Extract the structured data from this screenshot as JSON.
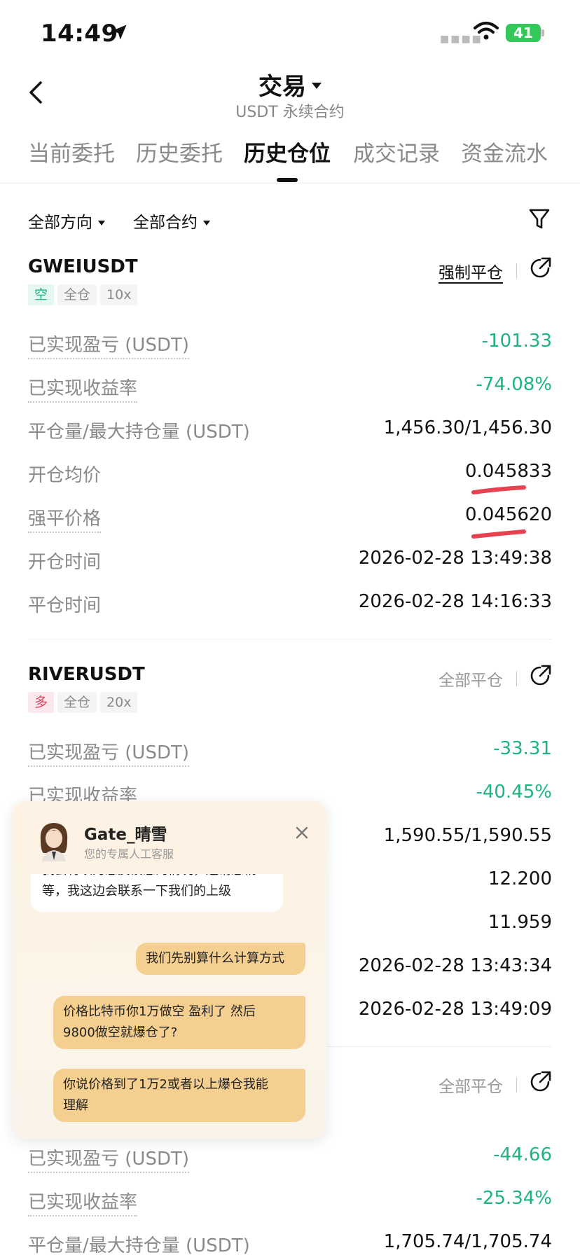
{
  "status_bar": {
    "time": "14:49",
    "battery": "41",
    "colors": {
      "battery": "#34c759"
    }
  },
  "header": {
    "title": "交易",
    "subtitle": "USDT 永续合约"
  },
  "tabs": [
    {
      "label": "当前委托",
      "active": false
    },
    {
      "label": "历史委托",
      "active": false
    },
    {
      "label": "历史仓位",
      "active": true
    },
    {
      "label": "成交记录",
      "active": false
    },
    {
      "label": "资金流水",
      "active": false
    }
  ],
  "filters": {
    "direction": "全部方向",
    "contract": "全部合约"
  },
  "positions": [
    {
      "symbol": "GWEIUSDT",
      "tags": [
        "空",
        "全仓",
        "10x"
      ],
      "close_type": "强制平仓",
      "rows": [
        {
          "label": "已实现盈亏 (USDT)",
          "value": "-101.33"
        },
        {
          "label": "已实现收益率",
          "value": "-74.08%"
        },
        {
          "label": "平仓量/最大持仓量 (USDT)",
          "value": "1,456.30/1,456.30"
        },
        {
          "label": "开仓均价",
          "value": "0.045833"
        },
        {
          "label": "强平价格",
          "value": "0.045620"
        },
        {
          "label": "开仓时间",
          "value": "2026-02-28 13:49:38"
        },
        {
          "label": "平仓时间",
          "value": "2026-02-28 14:16:33"
        }
      ]
    },
    {
      "symbol": "RIVERUSDT",
      "tags": [
        "多",
        "全仓",
        "20x"
      ],
      "close_type": "全部平仓",
      "rows": [
        {
          "label": "已实现盈亏 (USDT)",
          "value": "-33.31"
        },
        {
          "label": "已实现收益率",
          "value": "-40.45%"
        },
        {
          "label": "",
          "value": "1,590.55/1,590.55"
        },
        {
          "label": "",
          "value": "12.200"
        },
        {
          "label": "",
          "value": "11.959"
        },
        {
          "label": "",
          "value": "2026-02-28 13:43:34"
        },
        {
          "label": "",
          "value": "2026-02-28 13:49:09"
        }
      ]
    },
    {
      "symbol": "",
      "close_type": "全部平仓",
      "rows": [
        {
          "label": "已实现盈亏 (USDT)",
          "value": "-44.66"
        },
        {
          "label": "已实现收益率",
          "value": "-25.34%"
        },
        {
          "label": "平仓量/最大持仓量 (USDT)",
          "value": "1,705.74/1,705.74"
        }
      ]
    }
  ],
  "chat": {
    "agent_name": "Gate_晴雪",
    "agent_subtitle": "您的专属人工客服",
    "messages": [
      {
        "from": "agent",
        "text_line1": "我会将以为您反馈您的情况，还请您稍",
        "text_line2": "等，我这边会联系一下我们的上级"
      },
      {
        "from": "user",
        "text": "我们先别算什么计算方式"
      },
      {
        "from": "user",
        "text_line1": "价格比特币你1万做空 盈利了 然后",
        "text_line2": "9800做空就爆仓了?"
      },
      {
        "from": "user",
        "text_line1": "你说价格到了1万2或者以上爆仓我能",
        "text_line2": "理解"
      }
    ]
  },
  "colors": {
    "negative": "#1eb383",
    "short_tag": "#1eb383",
    "long_tag": "#e23f5b",
    "annotation_marks": "#e8414f",
    "user_bubble": "#f5cf8f"
  }
}
